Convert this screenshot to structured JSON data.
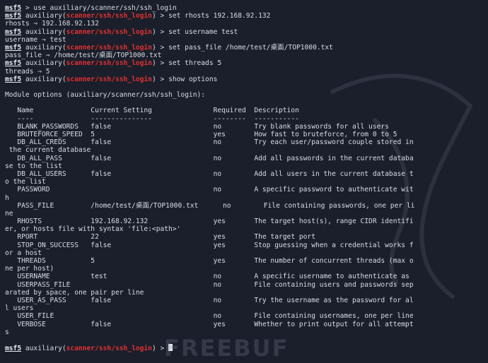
{
  "prompt": {
    "msf": "msf5",
    "prefix": " auxiliary(",
    "module": "scanner/ssh/ssh_login",
    "suffix": ") > "
  },
  "history": [
    {
      "type": "cmd",
      "plain": true,
      "command": "msf5 > use auxiliary/scanner/ssh/ssh_login"
    },
    {
      "type": "cmd",
      "command": "set rhosts 192.168.92.132"
    },
    {
      "type": "out",
      "text": "rhosts ⇒ 192.168.92.132"
    },
    {
      "type": "cmd",
      "command": "set username test"
    },
    {
      "type": "out",
      "text": "username ⇒ test"
    },
    {
      "type": "cmd",
      "command": "set pass_file /home/test/桌面/TOP1000.txt"
    },
    {
      "type": "out",
      "text": "pass_file ⇒ /home/test/桌面/TOP1000.txt"
    },
    {
      "type": "cmd",
      "command": "set threads 5"
    },
    {
      "type": "out",
      "text": "threads ⇒ 5"
    },
    {
      "type": "cmd",
      "command": "show options"
    },
    {
      "type": "out",
      "text": ""
    },
    {
      "type": "out",
      "text": "Module options (auxiliary/scanner/ssh/ssh_login):"
    },
    {
      "type": "out",
      "text": ""
    },
    {
      "type": "out",
      "text": "   Name              Current Setting               Required  Description"
    },
    {
      "type": "out",
      "text": "   ----              ---------------               --------  -----------"
    },
    {
      "type": "out",
      "text": "   BLANK_PASSWORDS   false                         no        Try blank passwords for all users"
    },
    {
      "type": "out",
      "text": "   BRUTEFORCE_SPEED  5                             yes       How fast to bruteforce, from 0 to 5"
    },
    {
      "type": "out",
      "text": "   DB_ALL_CREDS      false                         no        Try each user/password couple stored in"
    },
    {
      "type": "out",
      "text": " the current database"
    },
    {
      "type": "out",
      "text": "   DB_ALL_PASS       false                         no        Add all passwords in the current databa"
    },
    {
      "type": "out",
      "text": "se to the list"
    },
    {
      "type": "out",
      "text": "   DB_ALL_USERS      false                         no        Add all users in the current database t"
    },
    {
      "type": "out",
      "text": "o the list"
    },
    {
      "type": "out",
      "text": "   PASSWORD                                        no        A specific password to authenticate wit"
    },
    {
      "type": "out",
      "text": "h"
    },
    {
      "type": "out",
      "text": "   PASS_FILE         /home/test/桌面/TOP1000.txt      no        File containing passwords, one per li"
    },
    {
      "type": "out",
      "text": "ne"
    },
    {
      "type": "out",
      "text": "   RHOSTS            192.168.92.132                yes       The target host(s), range CIDR identifi"
    },
    {
      "type": "out",
      "text": "er, or hosts file with syntax 'file:<path>'"
    },
    {
      "type": "out",
      "text": "   RPORT             22                            yes       The target port"
    },
    {
      "type": "out",
      "text": "   STOP_ON_SUCCESS   false                         yes       Stop guessing when a credential works f"
    },
    {
      "type": "out",
      "text": "or a host"
    },
    {
      "type": "out",
      "text": "   THREADS           5                             yes       The number of concurrent threads (max o"
    },
    {
      "type": "out",
      "text": "ne per host)"
    },
    {
      "type": "out",
      "text": "   USERNAME          test                          no        A specific username to authenticate as"
    },
    {
      "type": "out",
      "text": "   USERPASS_FILE                                   no        File containing users and passwords sep"
    },
    {
      "type": "out",
      "text": "arated by space, one pair per line"
    },
    {
      "type": "out",
      "text": "   USER_AS_PASS      false                         no        Try the username as the password for al"
    },
    {
      "type": "out",
      "text": "l users"
    },
    {
      "type": "out",
      "text": "   USER_FILE                                       no        File containing usernames, one per line"
    },
    {
      "type": "out",
      "text": "   VERBOSE           false                         yes       Whether to print output for all attempt"
    },
    {
      "type": "out",
      "text": "s"
    },
    {
      "type": "out",
      "text": ""
    },
    {
      "type": "cmd",
      "command": ""
    }
  ],
  "watermark": "FREEBUF",
  "colors": {
    "background": "#1b1f2b",
    "text": "#d8dde4",
    "module_red": "#e03131",
    "dragon": "#3a4150"
  }
}
